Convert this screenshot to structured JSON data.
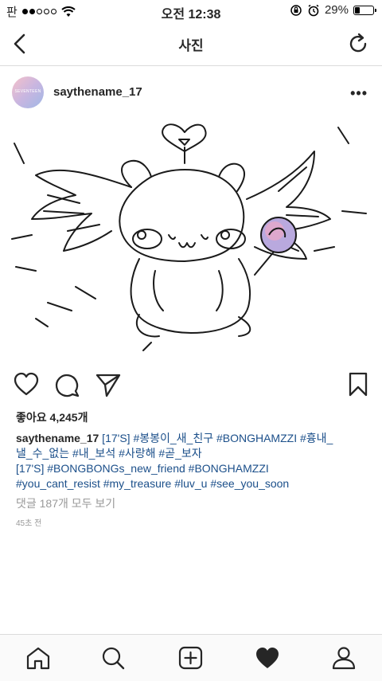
{
  "status_bar": {
    "carrier": "판",
    "time": "오전 12:38",
    "battery": "29%",
    "battery_level": 0.29,
    "signal_bars": 2
  },
  "nav": {
    "title": "사진"
  },
  "post": {
    "username": "saythename_17",
    "avatar_text": "SEVENTEEN",
    "likes": "좋아요 4,245개",
    "caption_user": "saythename_17",
    "caption_lines": [
      " [17'S] #봉봉이_새_친구 #BONGHAMZZI #흉내_",
      "낼_수_없는 #내_보석 #사랑해 #곧_보자",
      "[17'S] #BONGBONGs_new_friend #BONGHAMZZI",
      "#you_cant_resist #my_treasure #luv_u #see_you_soon"
    ],
    "comments_link": "댓글 187개 모두 보기",
    "time_ago": "45초 전"
  },
  "colors": {
    "hashtag": "#1b4f8a",
    "divider": "#dbdbdb",
    "muted": "#999999"
  },
  "icons": {
    "back": "chevron-left-icon",
    "refresh": "refresh-icon",
    "more": "more-icon",
    "like": "heart-icon",
    "comment": "comment-icon",
    "share": "send-icon",
    "save": "bookmark-icon",
    "tabs": [
      "home-icon",
      "search-icon",
      "add-icon",
      "heart-filled-icon",
      "profile-icon"
    ]
  }
}
